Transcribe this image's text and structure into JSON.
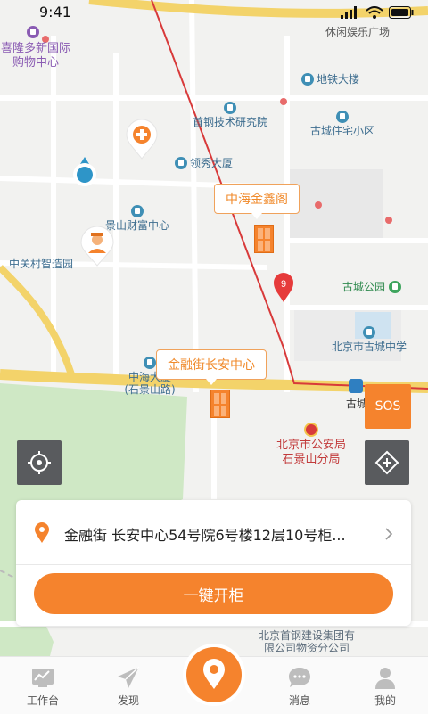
{
  "status_bar": {
    "time": "9:41"
  },
  "map": {
    "labels": {
      "mall": "喜隆多新国际\n购物中心",
      "leisure_plaza": "休闲娱乐广场",
      "ditie_building": "地铁大楼",
      "shougang_institute": "首钢技术研究院",
      "gucheng_residence": "古城住宅小区",
      "lingxiu_building": "领秀大厦",
      "jingshan_center": "景山财富中心",
      "zhongguancun": "中关村智造园",
      "gucheng_park": "古城公园",
      "gucheng_school": "北京市古城中学",
      "zhonghai_building": "中海大厦\n(石景山路)",
      "gucheng_short": "古城",
      "police": "北京市公安局\n石景山分局",
      "shougang_group": "北京首钢建设集团有\n限公司物资分公司"
    },
    "callouts": {
      "zhonghai_jinxin": "中海金鑫阁",
      "jinrongjie": "金融街长安中心"
    },
    "red_pin_number": "9"
  },
  "controls": {
    "sos_label": "SOS"
  },
  "card": {
    "address": "金融街 长安中心54号院6号楼12层10号柜...",
    "open_button": "一键开柜"
  },
  "tabbar": {
    "tabs": [
      {
        "label": "工作台"
      },
      {
        "label": "发现"
      },
      {
        "label": "消息"
      },
      {
        "label": "我的"
      }
    ]
  },
  "colors": {
    "accent": "#f5832d",
    "route": "#d83a3a",
    "road": "#f3d36a"
  }
}
